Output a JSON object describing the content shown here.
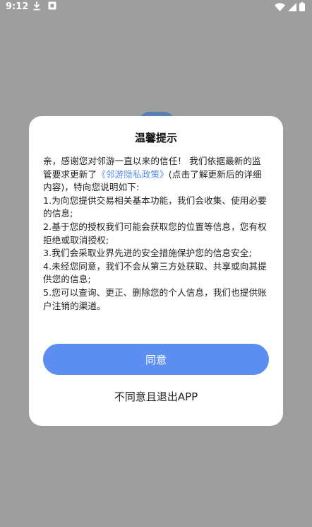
{
  "status_bar": {
    "time": "9:12"
  },
  "dialog": {
    "title": "温馨提示",
    "intro_before_link": "亲，感谢您对邻游一直以来的信任！ 我们依据最新的监管要求更新了",
    "policy_link": "《邻游隐私政策》",
    "intro_after_link": "(点击了解更新后的详细内容)，特向您说明如下:",
    "items": [
      "1.为向您提供交易相关基本功能，我们会收集、使用必要的信息;",
      "2.基于您的授权我们可能会获取您的位置等信息，您有权拒绝或取消授权;",
      "3.我们会采取业界先进的安全措施保护您的信息安全;",
      "4.未经您同意，我们不会从第三方处获取、共享或向其提供您的信息;",
      "5.您可以查询、更正、删除您的个人信息，我们也提供账户注销的渠道。"
    ],
    "agree_label": "同意",
    "disagree_label": "不同意且退出APP"
  },
  "colors": {
    "overlay": "#9e9e9e",
    "accent": "#5b8ef0",
    "link": "#5a8ff0"
  }
}
